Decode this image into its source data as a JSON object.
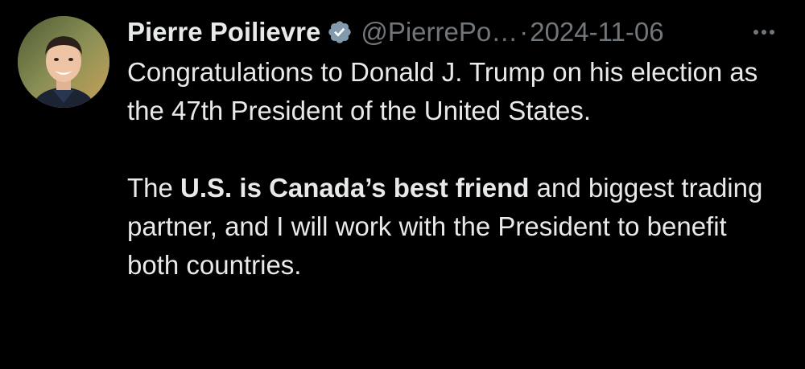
{
  "tweet": {
    "author": {
      "display_name": "Pierre Poilievre",
      "handle_truncated": "@PierrePo…",
      "verified_icon": "verified-badge-icon",
      "avatar_icon": "profile-photo"
    },
    "separator": "·",
    "date": "2024-11-06",
    "more_icon": "more-options-icon",
    "body": {
      "paragraph1": "Congratulations to Donald J. Trump on his election as the 47th President of the United States.",
      "paragraph2": {
        "before": "The ",
        "bold1": "U.S. is Canada’s best friend",
        "after": " and biggest trading partner, and I will work with the President to benefit both countries."
      }
    },
    "colors": {
      "background": "#000000",
      "text": "#e7e9ea",
      "muted": "#71767b",
      "verified": "#829aab"
    }
  }
}
